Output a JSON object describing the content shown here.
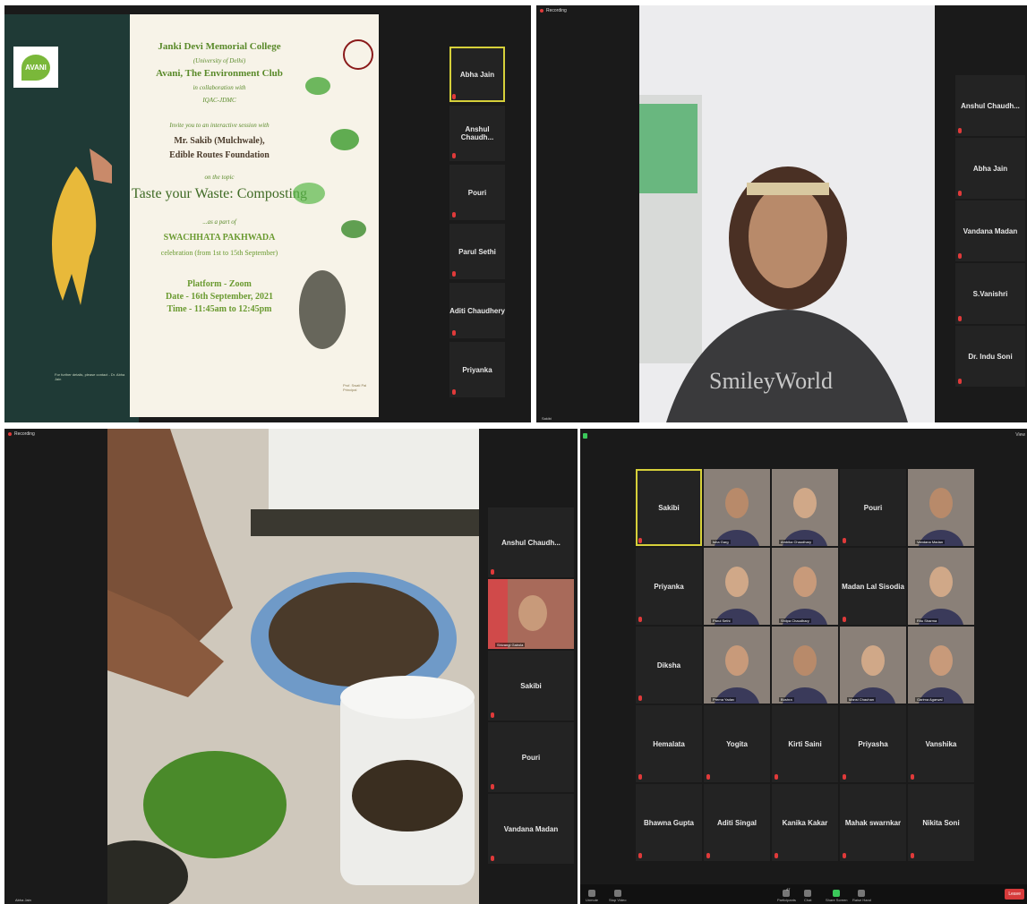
{
  "panel1": {
    "poster": {
      "college": "Janki Devi Memorial College",
      "university": "(University of Delhi)",
      "club": "Avani, The Environment Club",
      "collab": "in collaboration with",
      "iqac": "IQAC-JDMC",
      "invite": "Invite you to an interactive session with",
      "speaker": "Mr. Sakib (Mulchwale),",
      "org": "Edible Routes Foundation",
      "topic_intro": "on the topic",
      "topic": "Taste your Waste: Composting",
      "part_of": "...as a part of",
      "event": "SWACHHATA PAKHWADA",
      "celebration": "celebration (from 1st to 15th September)",
      "platform": "Platform - Zoom",
      "date": "Date - 16th September, 2021",
      "time": "Time - 11:45am to 12:45pm",
      "logo": "AVANI",
      "contact": "For further details, please contact - Dr. Abha Jain",
      "principal": "Prof. Swati Pal Principal"
    },
    "participants": [
      "Abha Jain",
      "Anshul Chaudh...",
      "Pouri",
      "Parul Sethi",
      "Aditi Chaudhery",
      "Priyanka"
    ]
  },
  "panel2": {
    "recording": "Recording",
    "participants": [
      "Anshul Chaudh...",
      "Abha Jain",
      "Vandana Madan",
      "S.Vanishri",
      "Dr. Indu Soni"
    ],
    "self_label": "Sakibi",
    "shirt": "SmileyWorld"
  },
  "panel3": {
    "recording": "Recording",
    "participants": [
      "Anshul Chaudh...",
      "Sakibi",
      "Pouri",
      "Vandana Madan"
    ],
    "video_tile_name": "Shivangi Gairola",
    "self_label": "Abha Jain"
  },
  "panel4": {
    "view_label": "View",
    "grid": [
      [
        "Sakibi",
        "Isha Garg",
        "Ambika Chaudhary",
        "Pouri",
        "Vandana Madan"
      ],
      [
        "Priyanka",
        "Parul Sethi",
        "Shilpa Chaudhary",
        "Madan Lal Sisodia",
        "Ritu Sharma"
      ],
      [
        "Diksha",
        "Prerna Yadav",
        "Bushra",
        "Mansi Chauhan",
        "Garima Agarwal"
      ],
      [
        "Hemalata",
        "Yogita",
        "Kirti Saini",
        "Priyasha",
        "Vanshika"
      ],
      [
        "Bhawna Gupta",
        "Aditi Singal",
        "Kanika Kakar",
        "Mahak swarnkar",
        "Nikita Soni"
      ]
    ],
    "toolbar": {
      "unmute": "Unmute",
      "stop_video": "Stop Video",
      "participants": "Participants",
      "participants_count": "47",
      "chat": "Chat",
      "share": "Share Screen",
      "raise": "Raise Hand",
      "leave": "Leave"
    }
  },
  "colors": {
    "active_border": "#d6d03a",
    "muted": "#e03a3a",
    "leave": "#d63a3a"
  }
}
